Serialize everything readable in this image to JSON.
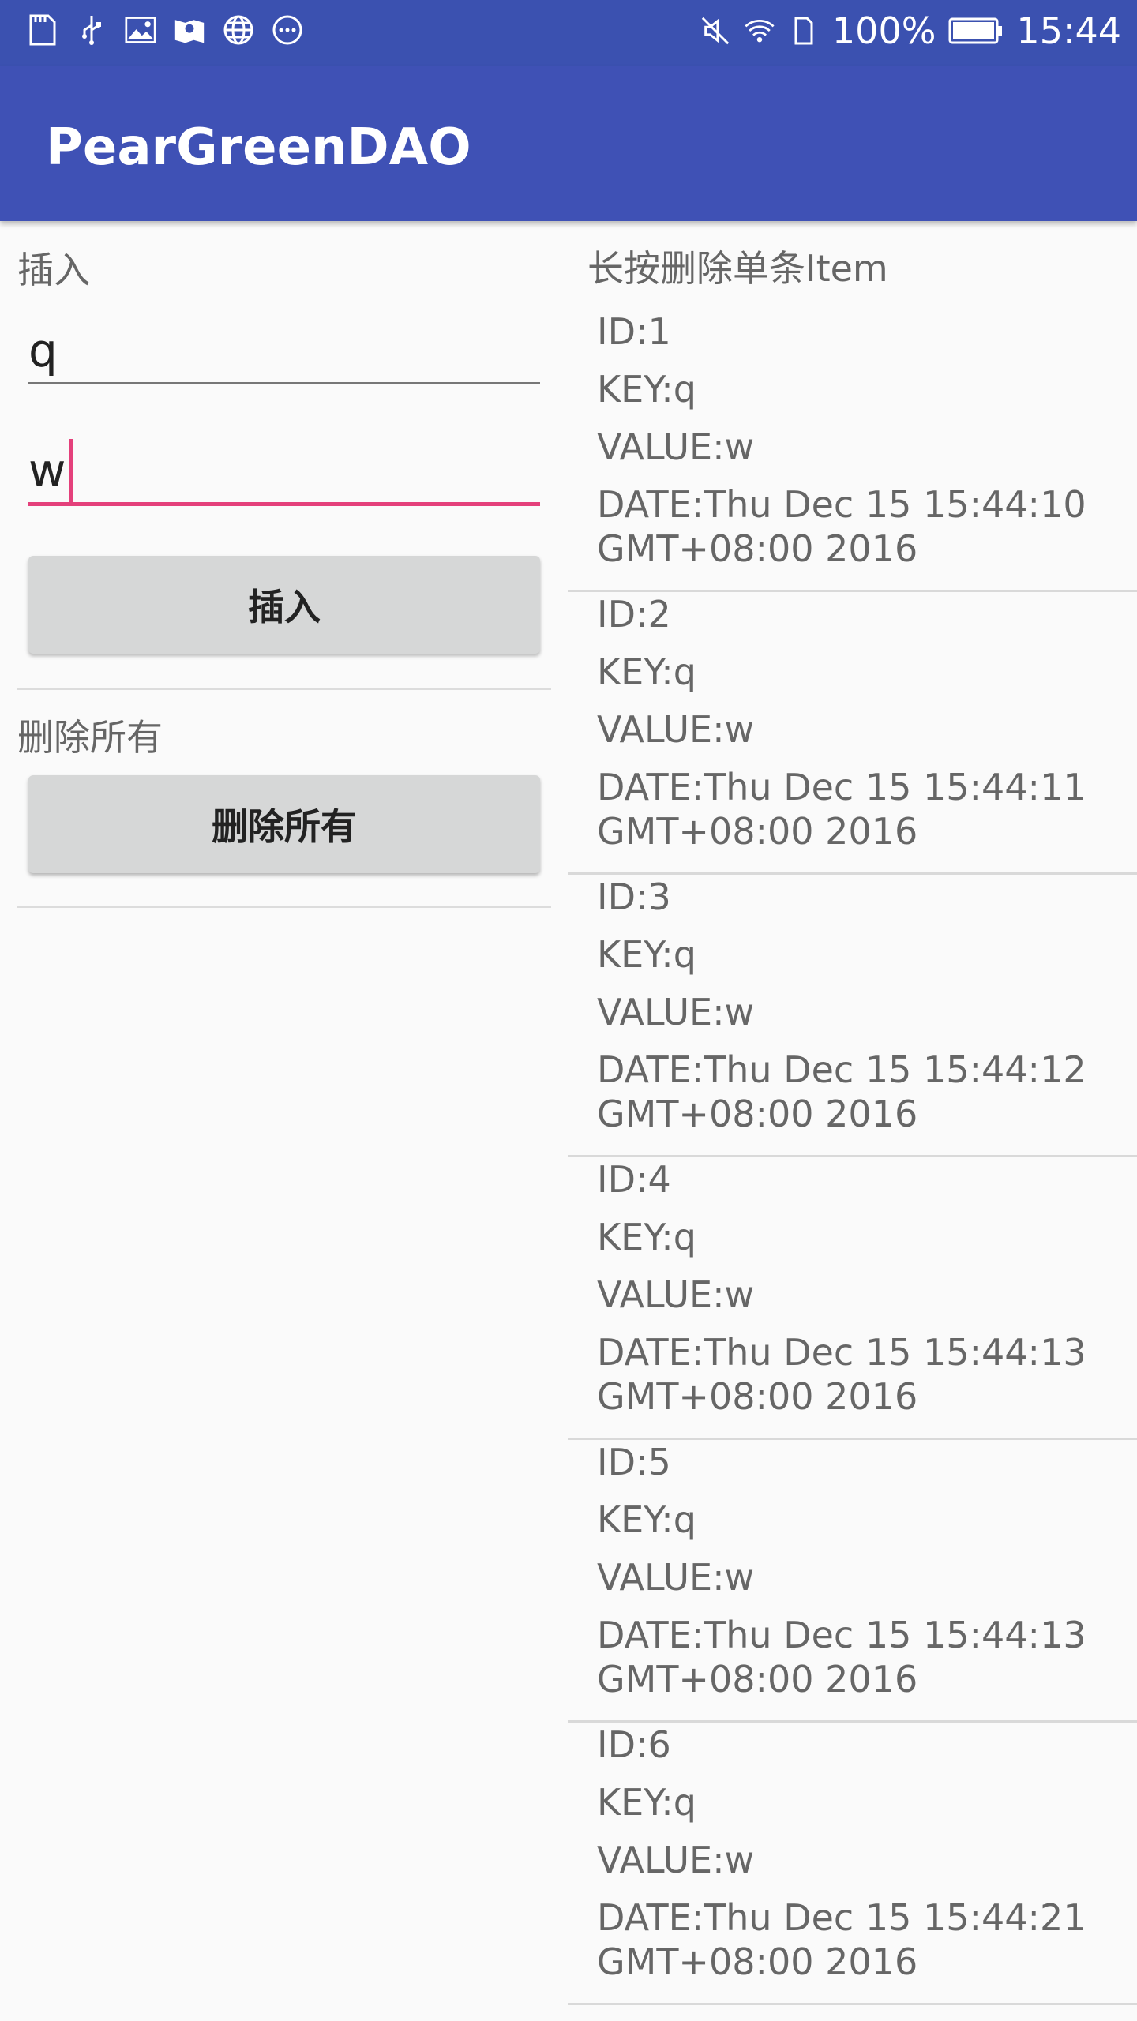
{
  "status_bar": {
    "icons_left": [
      "sd-card-icon",
      "usb-icon",
      "image-icon",
      "gallery-icon",
      "globe-icon",
      "more-icon"
    ],
    "battery_percent": "100%",
    "time": "15:44"
  },
  "app_bar": {
    "title": "PearGreenDAO"
  },
  "insert_section": {
    "label": "插入",
    "key_value": "q",
    "value_value": "w",
    "button": "插入"
  },
  "delete_section": {
    "label": "删除所有",
    "button": "删除所有"
  },
  "list": {
    "header": "长按删除单条Item",
    "items": [
      {
        "id": "ID:1",
        "key": "KEY:q",
        "value": "VALUE:w",
        "date": "DATE:Thu Dec 15 15:44:10 GMT+08:00 2016"
      },
      {
        "id": "ID:2",
        "key": "KEY:q",
        "value": "VALUE:w",
        "date": "DATE:Thu Dec 15 15:44:11 GMT+08:00 2016"
      },
      {
        "id": "ID:3",
        "key": "KEY:q",
        "value": "VALUE:w",
        "date": "DATE:Thu Dec 15 15:44:12 GMT+08:00 2016"
      },
      {
        "id": "ID:4",
        "key": "KEY:q",
        "value": "VALUE:w",
        "date": "DATE:Thu Dec 15 15:44:13 GMT+08:00 2016"
      },
      {
        "id": "ID:5",
        "key": "KEY:q",
        "value": "VALUE:w",
        "date": "DATE:Thu Dec 15 15:44:13 GMT+08:00 2016"
      },
      {
        "id": "ID:6",
        "key": "KEY:q",
        "value": "VALUE:w",
        "date": "DATE:Thu Dec 15 15:44:21 GMT+08:00 2016"
      }
    ]
  },
  "colors": {
    "primary": "#3f51b5",
    "status_bar": "#3b51b0",
    "accent": "#e4407b"
  }
}
